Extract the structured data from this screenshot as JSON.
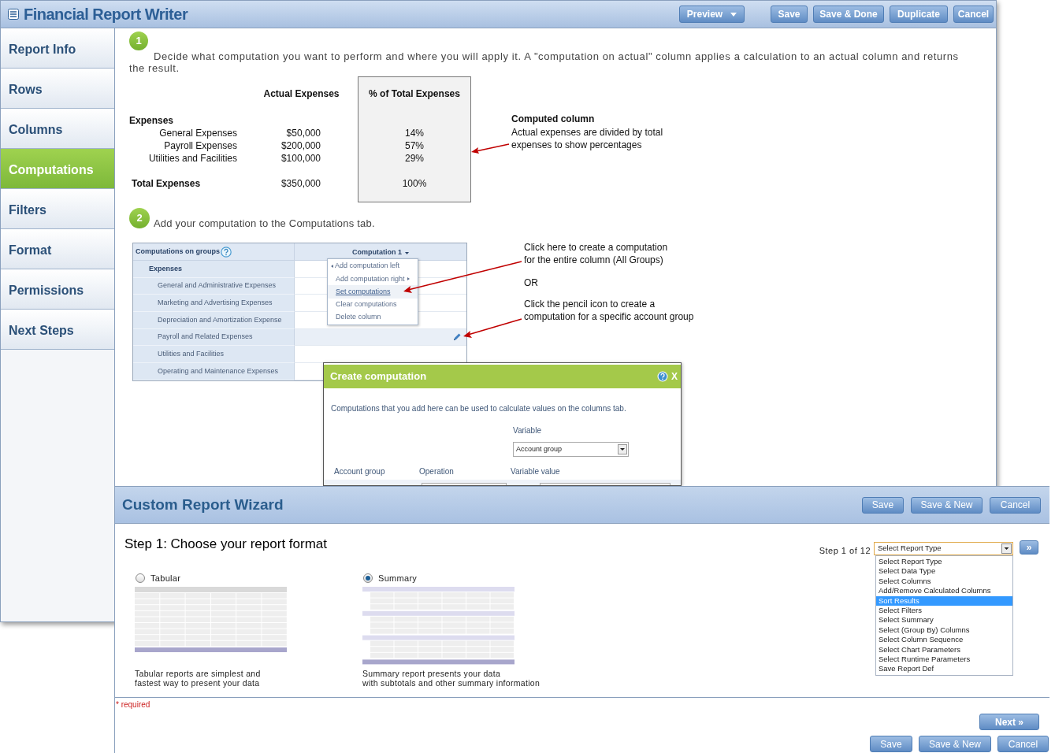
{
  "app": {
    "title": "Financial Report Writer",
    "buttons": [
      {
        "label": "Preview",
        "kind": "dropdown"
      },
      {
        "label": "Save",
        "kind": "button"
      },
      {
        "label": "Save & Done",
        "kind": "button"
      },
      {
        "label": "Duplicate",
        "kind": "button"
      },
      {
        "label": "Cancel",
        "kind": "button"
      }
    ]
  },
  "sidebar": [
    {
      "label": "Report Info",
      "selected": false
    },
    {
      "label": "Rows",
      "selected": false
    },
    {
      "label": "Columns",
      "selected": false
    },
    {
      "label": "Computations",
      "selected": true
    },
    {
      "label": "Filters",
      "selected": false
    },
    {
      "label": "Format",
      "selected": false
    },
    {
      "label": "Permissions",
      "selected": false
    },
    {
      "label": "Next Steps",
      "selected": false
    }
  ],
  "step_1": {
    "number": "1",
    "text": "Decide what computation you want to perform and where you will apply it. A \"computation on actual\" column applies a calculation to an actual column and returns the result."
  },
  "example": {
    "columns": [
      "Actual Expenses",
      "% of Total Expenses"
    ],
    "rows": [
      {
        "kind": "group",
        "label": "Expenses"
      },
      {
        "kind": "item",
        "label": "General Expenses",
        "actual": "$50,000",
        "percent": "14%"
      },
      {
        "kind": "item",
        "label": "Payroll Expenses",
        "actual": "$200,000",
        "percent": "57%"
      },
      {
        "kind": "item",
        "label": "Utilities and Facilities",
        "actual": "$100,000",
        "percent": "29%"
      },
      {
        "kind": "total",
        "label": "Total Expenses",
        "actual": "$350,000",
        "percent": "100%"
      }
    ],
    "callout": {
      "title": "Computed column",
      "lines": [
        "Actual expenses are divided by total",
        "expenses to show percentages"
      ]
    }
  },
  "step_2": {
    "number": "2",
    "text": "Add your computation to the Computations tab."
  },
  "groups_grid": {
    "title": "Computations on groups",
    "column": "Computation 1",
    "rows": [
      {
        "kind": "group",
        "label": "Expenses",
        "hovered": false
      },
      {
        "kind": "item",
        "label": "General and Administrative Expenses",
        "hovered": false
      },
      {
        "kind": "item",
        "label": "Marketing and Advertising Expenses",
        "hovered": false
      },
      {
        "kind": "item",
        "label": "Depreciation and Amortization Expense",
        "hovered": false
      },
      {
        "kind": "item",
        "label": "Payroll and Related Expenses",
        "hovered": true
      },
      {
        "kind": "item",
        "label": "Utilities and Facilities",
        "hovered": false
      },
      {
        "kind": "item",
        "label": "Operating and Maintenance Expenses",
        "hovered": false
      }
    ],
    "menu": [
      {
        "label": "Add computation left",
        "kind": "left",
        "selected": false
      },
      {
        "label": "Add computation right",
        "kind": "right",
        "selected": false
      },
      {
        "label": "Set computations",
        "kind": "plain",
        "selected": true
      },
      {
        "label": "Clear computations",
        "kind": "plain",
        "selected": false
      },
      {
        "label": "Delete column",
        "kind": "plain",
        "selected": false
      }
    ]
  },
  "annotations": [
    {
      "kind": "note",
      "lines": [
        "Click here to create a computation",
        "for the entire column (All Groups)"
      ]
    },
    {
      "kind": "or",
      "lines": [
        "OR"
      ]
    },
    {
      "kind": "note",
      "lines": [
        "Click the pencil icon to create a",
        "computation for a specific account group"
      ]
    }
  ],
  "dialog": {
    "title": "Create computation",
    "close": "X",
    "intro": "Computations that you add here can be used to calculate values on the columns tab.",
    "variable_label": "Variable",
    "variable_value": "Account group",
    "columns": [
      "Account group",
      "Operation",
      "Variable value"
    ]
  },
  "wizard": {
    "title": "Custom Report Wizard",
    "buttons": [
      "Save",
      "Save & New",
      "Cancel"
    ],
    "heading": "Step 1: Choose your report format",
    "formats": [
      {
        "kind": "tabular",
        "label": "Tabular",
        "selected": false,
        "lines": [
          "Tabular reports are simplest and",
          "fastest way to present your data"
        ]
      },
      {
        "kind": "summary",
        "label": "Summary",
        "selected": true,
        "lines": [
          "Summary report presents your data",
          "with subtotals and other summary information"
        ]
      }
    ],
    "step_label": "Step 1 of 12",
    "step_select": {
      "value": "Select Report Type",
      "options": [
        {
          "label": "Select Report Type",
          "highlighted": false
        },
        {
          "label": "Select Data Type",
          "highlighted": false
        },
        {
          "label": "Select Columns",
          "highlighted": false
        },
        {
          "label": "Add/Remove Calculated Columns",
          "highlighted": false
        },
        {
          "label": "Sort Results",
          "highlighted": true
        },
        {
          "label": "Select Filters",
          "highlighted": false
        },
        {
          "label": "Select Summary",
          "highlighted": false
        },
        {
          "label": "Select (Group By) Columns",
          "highlighted": false
        },
        {
          "label": "Select Column Sequence",
          "highlighted": false
        },
        {
          "label": "Select Chart Parameters",
          "highlighted": false
        },
        {
          "label": "Select Runtime Parameters",
          "highlighted": false
        },
        {
          "label": "Save Report Def",
          "highlighted": false
        }
      ]
    },
    "jump_button": "»",
    "required": "* required",
    "next_button": "Next »",
    "footer_buttons": [
      "Save",
      "Save & New",
      "Cancel"
    ]
  }
}
